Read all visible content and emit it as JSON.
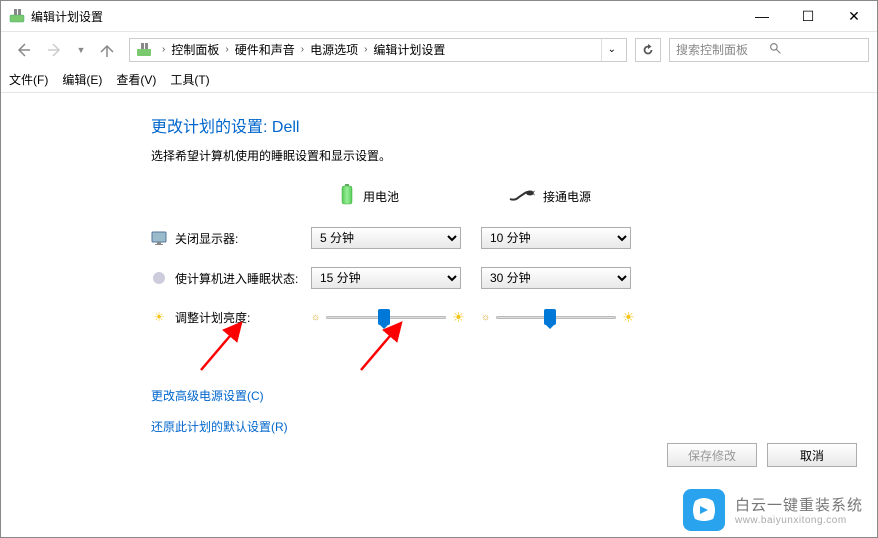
{
  "window": {
    "title": "编辑计划设置",
    "controls": {
      "minimize": "—",
      "maximize": "☐",
      "close": "✕"
    }
  },
  "nav": {
    "breadcrumb": {
      "root": "控制面板",
      "item1": "硬件和声音",
      "item2": "电源选项",
      "item3": "编辑计划设置"
    },
    "search_placeholder": "搜索控制面板"
  },
  "menu": {
    "file": "文件(F)",
    "edit": "编辑(E)",
    "view": "查看(V)",
    "tools": "工具(T)"
  },
  "page": {
    "title": "更改计划的设置: Dell",
    "subtitle": "选择希望计算机使用的睡眠设置和显示设置。"
  },
  "columns": {
    "battery": "用电池",
    "plugged": "接通电源"
  },
  "rows": {
    "display_off": "关闭显示器:",
    "sleep": "使计算机进入睡眠状态:",
    "brightness": "调整计划亮度:"
  },
  "values": {
    "display_off_battery": "5 分钟",
    "display_off_plugged": "10 分钟",
    "sleep_battery": "15 分钟",
    "sleep_plugged": "30 分钟",
    "brightness_battery_pct": 48,
    "brightness_plugged_pct": 45
  },
  "links": {
    "advanced": "更改高级电源设置(C)",
    "restore": "还原此计划的默认设置(R)"
  },
  "buttons": {
    "save": "保存修改",
    "cancel": "取消"
  },
  "watermark": {
    "line1": "白云一键重装系统",
    "line2": "www.baiyunxitong.com"
  }
}
